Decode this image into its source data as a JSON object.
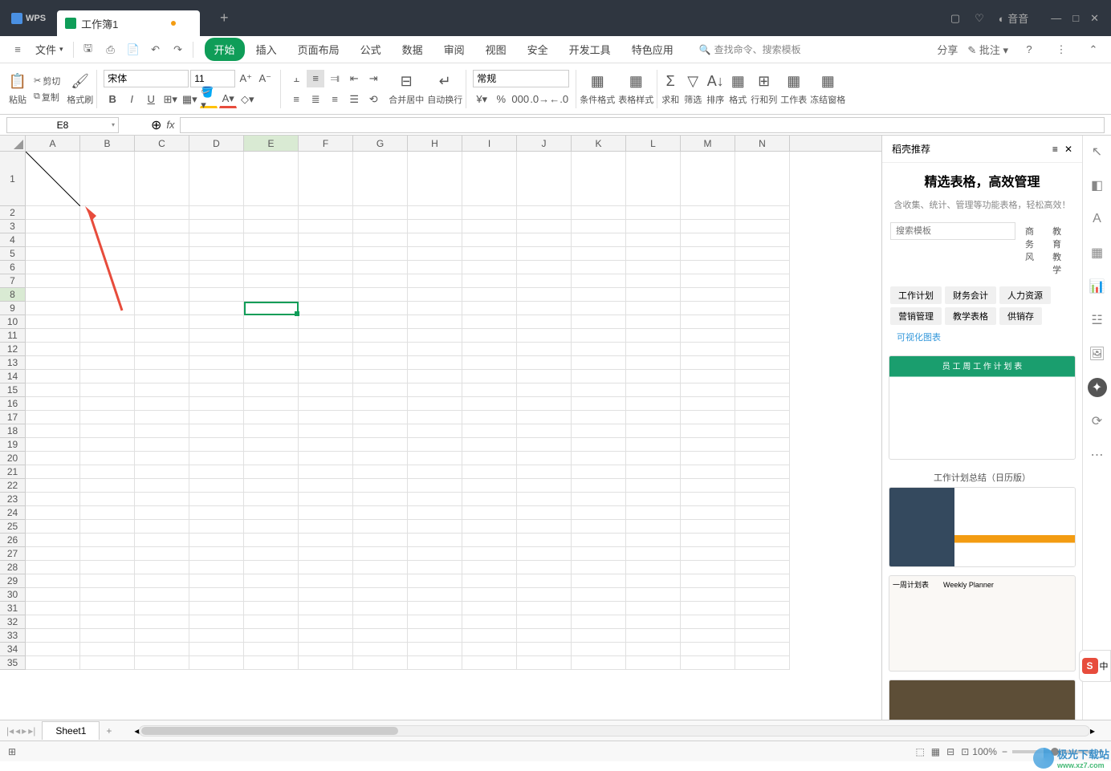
{
  "app": {
    "name": "WPS"
  },
  "tabs": {
    "workbook_name": "工作簿1"
  },
  "menu": {
    "file": "文件",
    "items": [
      "开始",
      "插入",
      "页面布局",
      "公式",
      "数据",
      "审阅",
      "视图",
      "安全",
      "开发工具",
      "特色应用"
    ],
    "search_placeholder": "查找命令、搜索模板",
    "share": "分享",
    "comment": "批注"
  },
  "ribbon": {
    "paste": "粘贴",
    "cut": "剪切",
    "copy": "复制",
    "format_painter": "格式刷",
    "font_name": "宋体",
    "font_size": "11",
    "merge": "合并居中",
    "wrap": "自动换行",
    "number_format": "常规",
    "cond_fmt": "条件格式",
    "table_style": "表格样式",
    "sum": "求和",
    "filter": "筛选",
    "sort": "排序",
    "format": "格式",
    "rows_cols": "行和列",
    "sheet": "工作表",
    "freeze": "冻结窗格"
  },
  "cell_ref": "E8",
  "columns": [
    "A",
    "B",
    "C",
    "D",
    "E",
    "F",
    "G",
    "H",
    "I",
    "J",
    "K",
    "L",
    "M",
    "N"
  ],
  "rows": [
    1,
    2,
    3,
    4,
    5,
    6,
    7,
    8,
    9,
    10,
    11,
    12,
    13,
    14,
    15,
    16,
    17,
    18,
    19,
    20,
    21,
    22,
    23,
    24,
    25,
    26,
    27,
    28,
    29,
    30,
    31,
    32,
    33,
    34,
    35
  ],
  "sheet_tab": "Sheet1",
  "panel": {
    "header": "稻壳推荐",
    "title": "精选表格，高效管理",
    "subtitle": "含收集、统计、管理等功能表格，轻松高效！",
    "search_placeholder": "搜索模板",
    "tabs": [
      "商务风",
      "教育教学"
    ],
    "categories": [
      "工作计划",
      "财务会计",
      "人力资源",
      "营销管理",
      "教学表格",
      "供销存",
      "可视化图表"
    ],
    "template2_title": "工作计划总结（日历版）"
  },
  "status": {
    "zoom": "100%"
  },
  "watermark": {
    "text": "极光下载站",
    "url": "www.xz7.com"
  }
}
